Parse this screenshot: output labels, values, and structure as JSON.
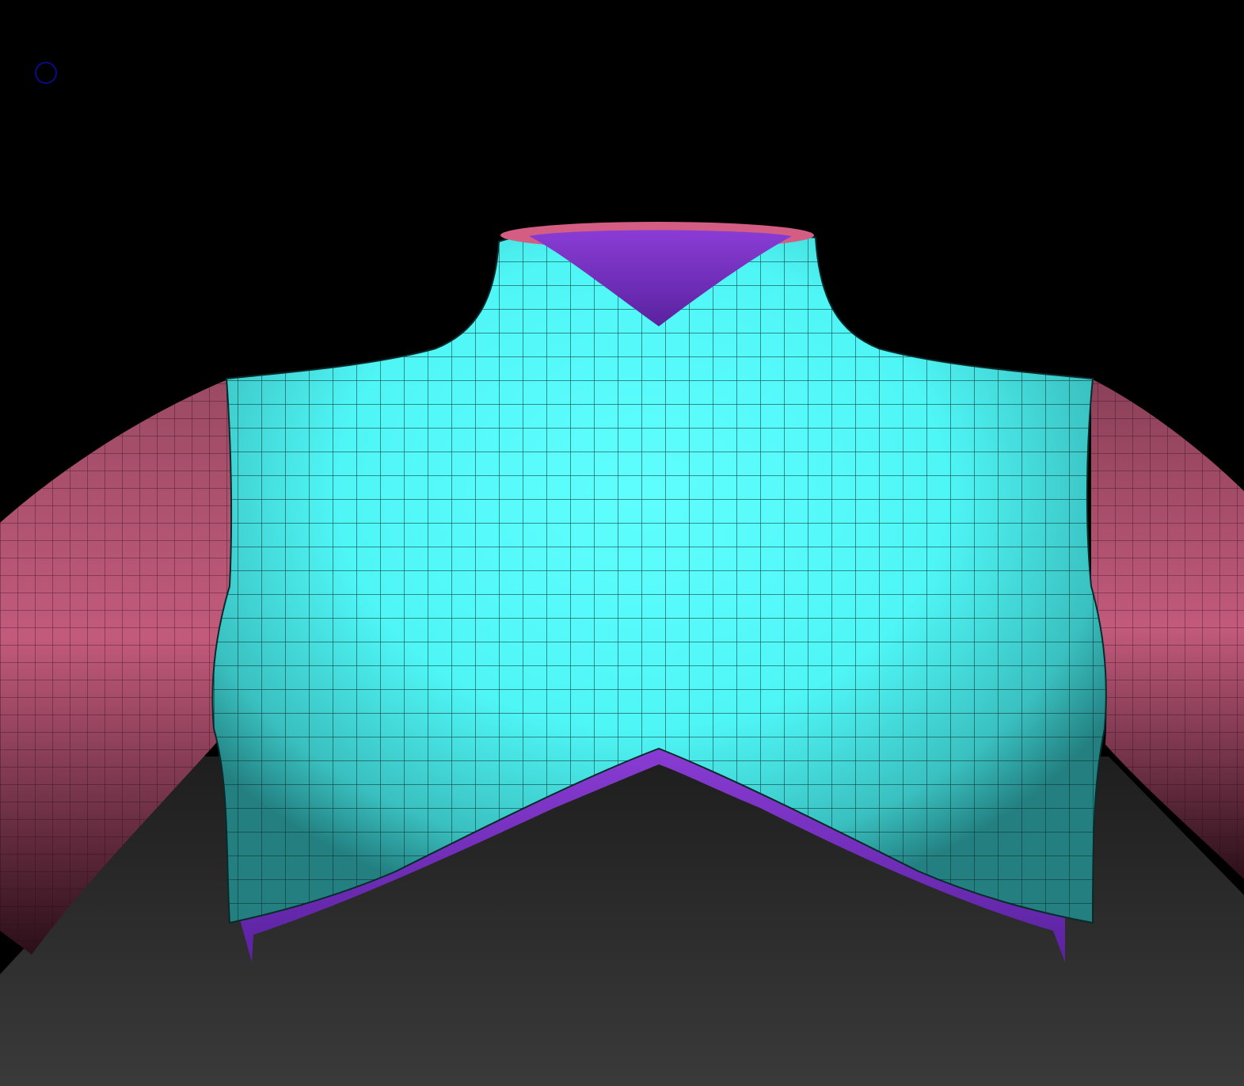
{
  "viewport": {
    "background": "#000000"
  },
  "scene": {
    "floor_color": "#2b2b2b",
    "floor_near_color": "#3a3a3a",
    "torso_color": "#4dfcfc",
    "torso_shadow_color": "#1f7f7f",
    "sleeve_color": "#c25a7c",
    "sleeve_shadow_color": "#3a1622",
    "inner_color": "#7a33c4",
    "collar_rim_color": "#d45d84",
    "wire_color": "#0a2a2a"
  },
  "brush_cursor": {
    "icon": "brush-circle-icon",
    "color": "#0b0b8a"
  }
}
